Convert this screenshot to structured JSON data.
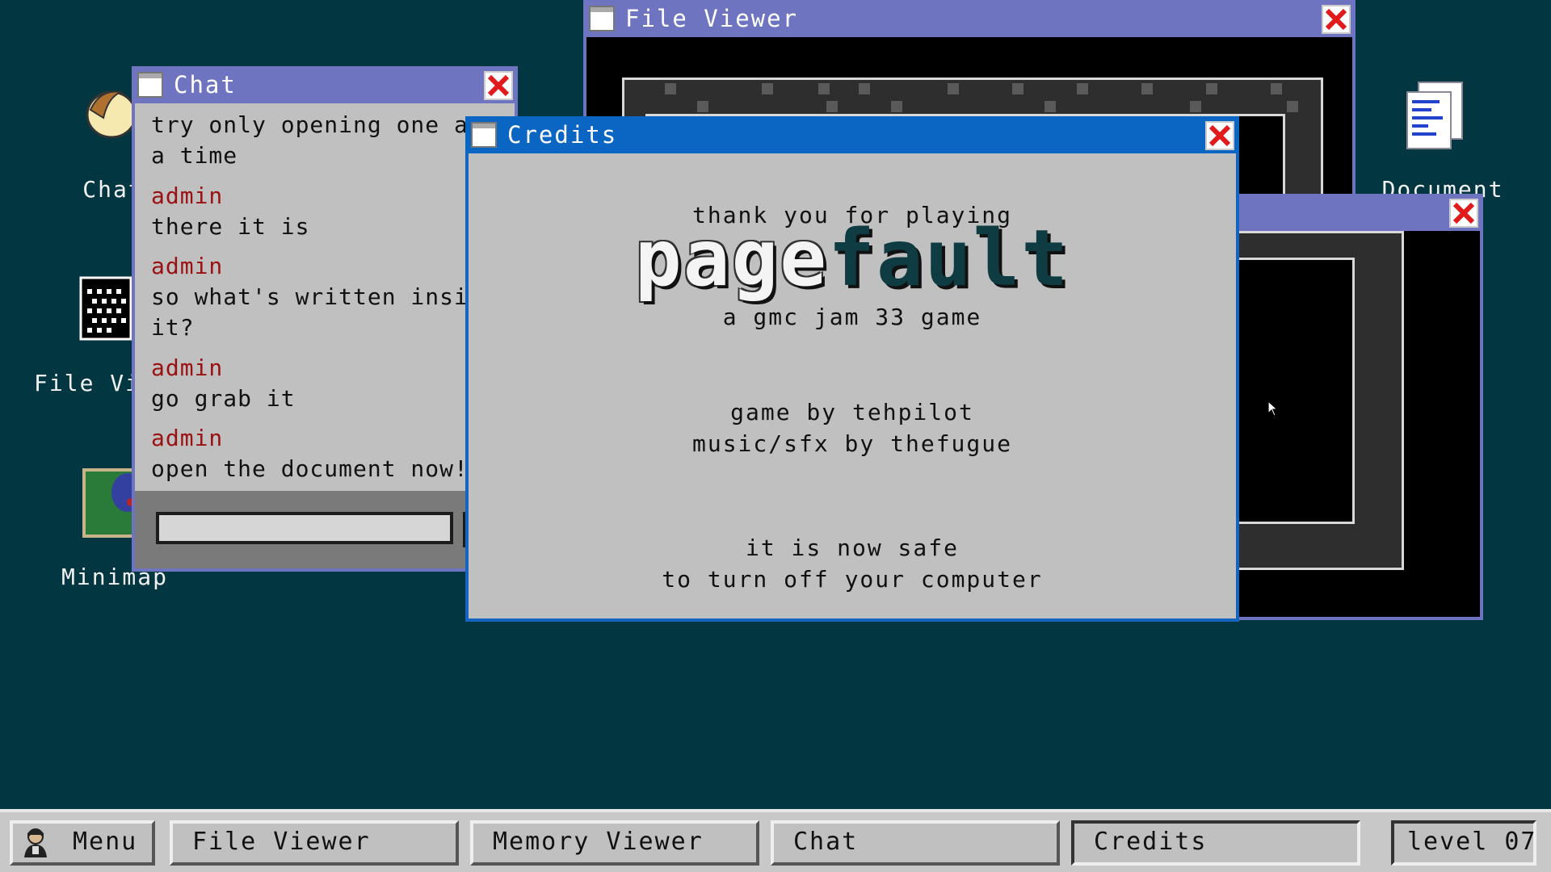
{
  "desktop": {
    "icons": [
      {
        "label": "Chat"
      },
      {
        "label": "File Viewer"
      },
      {
        "label": "Minimap"
      },
      {
        "label": "Document"
      }
    ]
  },
  "windows": {
    "file_viewer": {
      "title": "File Viewer"
    },
    "chat": {
      "title": "Chat",
      "messages": [
        {
          "user": "",
          "lines": [
            "try only opening one at",
            "a time"
          ]
        },
        {
          "user": "admin",
          "lines": [
            "there it is"
          ]
        },
        {
          "user": "admin",
          "lines": [
            "so what's written inside",
            "it?"
          ]
        },
        {
          "user": "admin",
          "lines": [
            "go grab it"
          ]
        },
        {
          "user": "admin",
          "lines": [
            "open the document now!"
          ]
        }
      ],
      "input_value": ""
    },
    "credits": {
      "title": "Credits",
      "thanks": "thank you for playing",
      "logo_part1": "page",
      "logo_part2": "fault",
      "subtitle": "a gmc jam 33 game",
      "credit_game": "game by tehpilot",
      "credit_music": "music/sfx by thefugue",
      "safe_line1": "it is now safe",
      "safe_line2": "to turn off your computer"
    }
  },
  "taskbar": {
    "menu": "Menu",
    "buttons": [
      "File Viewer",
      "Memory Viewer",
      "Chat",
      "Credits"
    ],
    "active": "Credits",
    "level": "level 07"
  },
  "colors": {
    "desktop": "#023640",
    "inactive_titlebar": "#6e74bf",
    "active_titlebar": "#0a66c2",
    "chat_username": "#9b1010",
    "close_x": "#e11b1b"
  }
}
